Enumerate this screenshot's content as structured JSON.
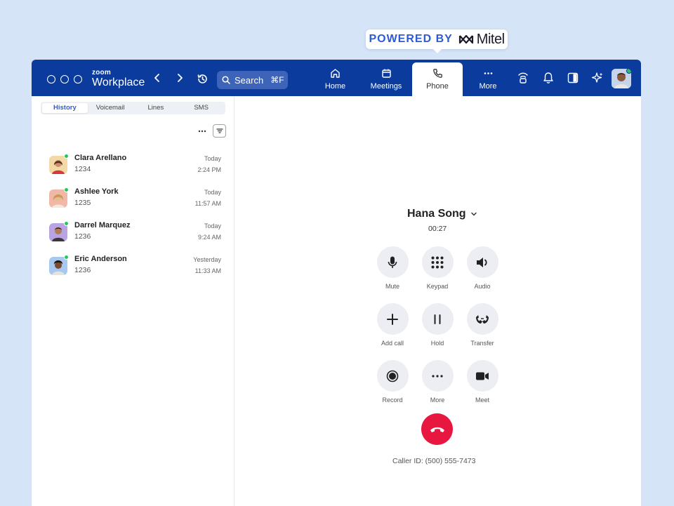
{
  "badge": {
    "powered_by": "POWERED BY",
    "brand": "Mitel"
  },
  "app": {
    "brand_small": "zoom",
    "brand_large": "Workplace"
  },
  "search": {
    "label": "Search",
    "shortcut": "⌘F"
  },
  "tabs": [
    {
      "label": "Home",
      "icon": "home-icon"
    },
    {
      "label": "Meetings",
      "icon": "calendar-icon"
    },
    {
      "label": "Phone",
      "icon": "phone-icon",
      "active": true
    },
    {
      "label": "More",
      "icon": "more-icon"
    }
  ],
  "subtabs": [
    "History",
    "Voicemail",
    "Lines",
    "SMS"
  ],
  "calls": [
    {
      "name": "Clara Arellano",
      "ext": "1234",
      "day": "Today",
      "time": "2:24 PM"
    },
    {
      "name": "Ashlee York",
      "ext": "1235",
      "day": "Today",
      "time": "11:57 AM"
    },
    {
      "name": "Darrel Marquez",
      "ext": "1236",
      "day": "Today",
      "time": "9:24 AM"
    },
    {
      "name": "Eric Anderson",
      "ext": "1236",
      "day": "Yesterday",
      "time": "11:33 AM"
    }
  ],
  "active_call": {
    "name": "Hana Song",
    "duration": "00:27",
    "caller_id": "Caller ID: (500) 555-7473",
    "controls": [
      "Mute",
      "Keypad",
      "Audio",
      "Add call",
      "Hold",
      "Transfer",
      "Record",
      "More",
      "Meet"
    ]
  },
  "colors": {
    "topbar": "#0b3b9c",
    "end_call": "#e8173f",
    "accent": "#2c5bd4",
    "presence": "#22c55e"
  }
}
